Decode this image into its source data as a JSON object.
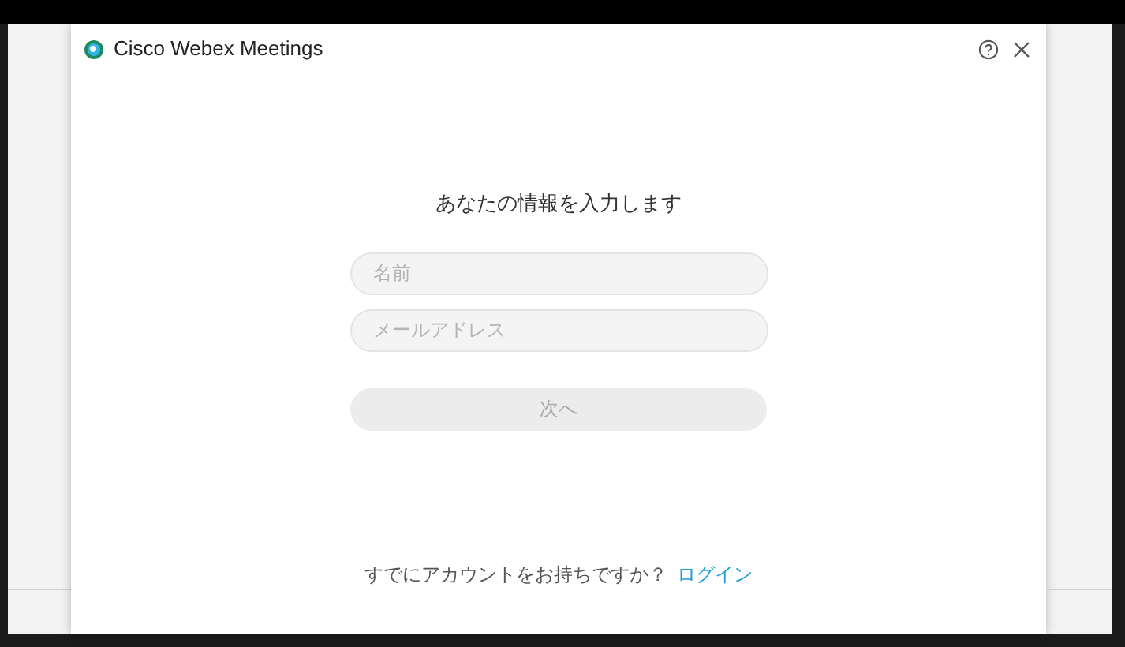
{
  "window": {
    "title": "Cisco Webex Meetings"
  },
  "form": {
    "heading": "あなたの情報を入力します",
    "fields": [
      {
        "placeholder": "名前"
      },
      {
        "placeholder": "メールアドレス"
      }
    ],
    "next_button": {
      "label": "次へ",
      "disabled": true
    }
  },
  "footer": {
    "text": "すでにアカウントをお持ちですか？",
    "link": "ログイン"
  }
}
